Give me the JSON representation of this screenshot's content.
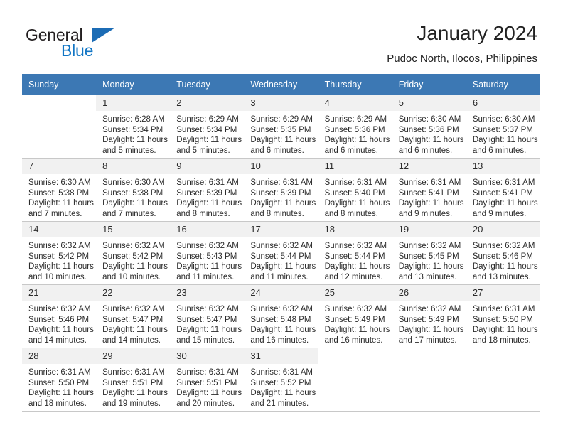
{
  "brand": {
    "name_part1": "General",
    "name_part2": "Blue",
    "triangle_color": "#1c6cb5",
    "blue_color": "#1175c4"
  },
  "header": {
    "title": "January 2024",
    "subtitle": "Pudoc North, Ilocos, Philippines"
  },
  "theme": {
    "header_row_bg": "#3c78b4",
    "header_row_text": "#ffffff",
    "daynum_bg": "#f1f1f1",
    "grid_line": "#c8c8c8"
  },
  "weekdays": [
    "Sunday",
    "Monday",
    "Tuesday",
    "Wednesday",
    "Thursday",
    "Friday",
    "Saturday"
  ],
  "labels": {
    "sunrise_prefix": "Sunrise:",
    "sunset_prefix": "Sunset:",
    "daylight_prefix": "Daylight:"
  },
  "weeks": [
    [
      {
        "day": "",
        "empty": true,
        "sunrise": "",
        "sunset": "",
        "daylight_line1": "",
        "daylight_line2": ""
      },
      {
        "day": "1",
        "sunrise": "Sunrise: 6:28 AM",
        "sunset": "Sunset: 5:34 PM",
        "daylight_line1": "Daylight: 11 hours",
        "daylight_line2": "and 5 minutes."
      },
      {
        "day": "2",
        "sunrise": "Sunrise: 6:29 AM",
        "sunset": "Sunset: 5:34 PM",
        "daylight_line1": "Daylight: 11 hours",
        "daylight_line2": "and 5 minutes."
      },
      {
        "day": "3",
        "sunrise": "Sunrise: 6:29 AM",
        "sunset": "Sunset: 5:35 PM",
        "daylight_line1": "Daylight: 11 hours",
        "daylight_line2": "and 6 minutes."
      },
      {
        "day": "4",
        "sunrise": "Sunrise: 6:29 AM",
        "sunset": "Sunset: 5:36 PM",
        "daylight_line1": "Daylight: 11 hours",
        "daylight_line2": "and 6 minutes."
      },
      {
        "day": "5",
        "sunrise": "Sunrise: 6:30 AM",
        "sunset": "Sunset: 5:36 PM",
        "daylight_line1": "Daylight: 11 hours",
        "daylight_line2": "and 6 minutes."
      },
      {
        "day": "6",
        "sunrise": "Sunrise: 6:30 AM",
        "sunset": "Sunset: 5:37 PM",
        "daylight_line1": "Daylight: 11 hours",
        "daylight_line2": "and 6 minutes."
      }
    ],
    [
      {
        "day": "7",
        "sunrise": "Sunrise: 6:30 AM",
        "sunset": "Sunset: 5:38 PM",
        "daylight_line1": "Daylight: 11 hours",
        "daylight_line2": "and 7 minutes."
      },
      {
        "day": "8",
        "sunrise": "Sunrise: 6:30 AM",
        "sunset": "Sunset: 5:38 PM",
        "daylight_line1": "Daylight: 11 hours",
        "daylight_line2": "and 7 minutes."
      },
      {
        "day": "9",
        "sunrise": "Sunrise: 6:31 AM",
        "sunset": "Sunset: 5:39 PM",
        "daylight_line1": "Daylight: 11 hours",
        "daylight_line2": "and 8 minutes."
      },
      {
        "day": "10",
        "sunrise": "Sunrise: 6:31 AM",
        "sunset": "Sunset: 5:39 PM",
        "daylight_line1": "Daylight: 11 hours",
        "daylight_line2": "and 8 minutes."
      },
      {
        "day": "11",
        "sunrise": "Sunrise: 6:31 AM",
        "sunset": "Sunset: 5:40 PM",
        "daylight_line1": "Daylight: 11 hours",
        "daylight_line2": "and 8 minutes."
      },
      {
        "day": "12",
        "sunrise": "Sunrise: 6:31 AM",
        "sunset": "Sunset: 5:41 PM",
        "daylight_line1": "Daylight: 11 hours",
        "daylight_line2": "and 9 minutes."
      },
      {
        "day": "13",
        "sunrise": "Sunrise: 6:31 AM",
        "sunset": "Sunset: 5:41 PM",
        "daylight_line1": "Daylight: 11 hours",
        "daylight_line2": "and 9 minutes."
      }
    ],
    [
      {
        "day": "14",
        "sunrise": "Sunrise: 6:32 AM",
        "sunset": "Sunset: 5:42 PM",
        "daylight_line1": "Daylight: 11 hours",
        "daylight_line2": "and 10 minutes."
      },
      {
        "day": "15",
        "sunrise": "Sunrise: 6:32 AM",
        "sunset": "Sunset: 5:42 PM",
        "daylight_line1": "Daylight: 11 hours",
        "daylight_line2": "and 10 minutes."
      },
      {
        "day": "16",
        "sunrise": "Sunrise: 6:32 AM",
        "sunset": "Sunset: 5:43 PM",
        "daylight_line1": "Daylight: 11 hours",
        "daylight_line2": "and 11 minutes."
      },
      {
        "day": "17",
        "sunrise": "Sunrise: 6:32 AM",
        "sunset": "Sunset: 5:44 PM",
        "daylight_line1": "Daylight: 11 hours",
        "daylight_line2": "and 11 minutes."
      },
      {
        "day": "18",
        "sunrise": "Sunrise: 6:32 AM",
        "sunset": "Sunset: 5:44 PM",
        "daylight_line1": "Daylight: 11 hours",
        "daylight_line2": "and 12 minutes."
      },
      {
        "day": "19",
        "sunrise": "Sunrise: 6:32 AM",
        "sunset": "Sunset: 5:45 PM",
        "daylight_line1": "Daylight: 11 hours",
        "daylight_line2": "and 13 minutes."
      },
      {
        "day": "20",
        "sunrise": "Sunrise: 6:32 AM",
        "sunset": "Sunset: 5:46 PM",
        "daylight_line1": "Daylight: 11 hours",
        "daylight_line2": "and 13 minutes."
      }
    ],
    [
      {
        "day": "21",
        "sunrise": "Sunrise: 6:32 AM",
        "sunset": "Sunset: 5:46 PM",
        "daylight_line1": "Daylight: 11 hours",
        "daylight_line2": "and 14 minutes."
      },
      {
        "day": "22",
        "sunrise": "Sunrise: 6:32 AM",
        "sunset": "Sunset: 5:47 PM",
        "daylight_line1": "Daylight: 11 hours",
        "daylight_line2": "and 14 minutes."
      },
      {
        "day": "23",
        "sunrise": "Sunrise: 6:32 AM",
        "sunset": "Sunset: 5:47 PM",
        "daylight_line1": "Daylight: 11 hours",
        "daylight_line2": "and 15 minutes."
      },
      {
        "day": "24",
        "sunrise": "Sunrise: 6:32 AM",
        "sunset": "Sunset: 5:48 PM",
        "daylight_line1": "Daylight: 11 hours",
        "daylight_line2": "and 16 minutes."
      },
      {
        "day": "25",
        "sunrise": "Sunrise: 6:32 AM",
        "sunset": "Sunset: 5:49 PM",
        "daylight_line1": "Daylight: 11 hours",
        "daylight_line2": "and 16 minutes."
      },
      {
        "day": "26",
        "sunrise": "Sunrise: 6:32 AM",
        "sunset": "Sunset: 5:49 PM",
        "daylight_line1": "Daylight: 11 hours",
        "daylight_line2": "and 17 minutes."
      },
      {
        "day": "27",
        "sunrise": "Sunrise: 6:31 AM",
        "sunset": "Sunset: 5:50 PM",
        "daylight_line1": "Daylight: 11 hours",
        "daylight_line2": "and 18 minutes."
      }
    ],
    [
      {
        "day": "28",
        "sunrise": "Sunrise: 6:31 AM",
        "sunset": "Sunset: 5:50 PM",
        "daylight_line1": "Daylight: 11 hours",
        "daylight_line2": "and 18 minutes."
      },
      {
        "day": "29",
        "sunrise": "Sunrise: 6:31 AM",
        "sunset": "Sunset: 5:51 PM",
        "daylight_line1": "Daylight: 11 hours",
        "daylight_line2": "and 19 minutes."
      },
      {
        "day": "30",
        "sunrise": "Sunrise: 6:31 AM",
        "sunset": "Sunset: 5:51 PM",
        "daylight_line1": "Daylight: 11 hours",
        "daylight_line2": "and 20 minutes."
      },
      {
        "day": "31",
        "sunrise": "Sunrise: 6:31 AM",
        "sunset": "Sunset: 5:52 PM",
        "daylight_line1": "Daylight: 11 hours",
        "daylight_line2": "and 21 minutes."
      },
      {
        "day": "",
        "empty": true,
        "sunrise": "",
        "sunset": "",
        "daylight_line1": "",
        "daylight_line2": ""
      },
      {
        "day": "",
        "empty": true,
        "sunrise": "",
        "sunset": "",
        "daylight_line1": "",
        "daylight_line2": ""
      },
      {
        "day": "",
        "empty": true,
        "sunrise": "",
        "sunset": "",
        "daylight_line1": "",
        "daylight_line2": ""
      }
    ]
  ]
}
